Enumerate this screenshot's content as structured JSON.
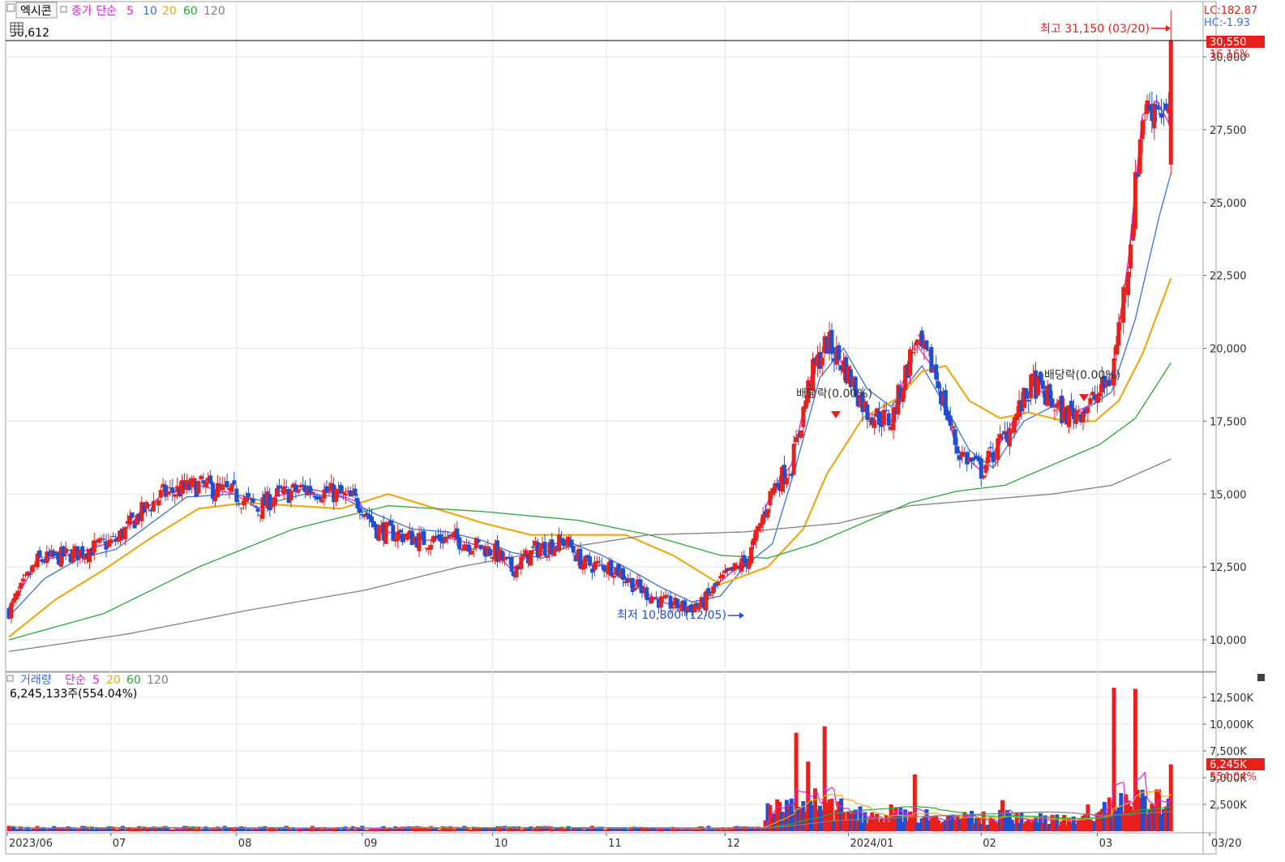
{
  "header": {
    "stock_name": "엑시콘",
    "price_ma_label": "종가 단순",
    "ma_periods": [
      "5",
      "10",
      "20",
      "60",
      "120"
    ],
    "top_left_value": "30,612",
    "lc_label": "LC:182.87",
    "hc_label": "HC:-1.93"
  },
  "volume_header": {
    "label": "거래량",
    "ma_label": "단순",
    "ma_periods": [
      "5",
      "20",
      "60",
      "120"
    ],
    "value_text": "6,245,133주(554.04%)"
  },
  "colors": {
    "up": "#e8201c",
    "down": "#1f4fd0",
    "ma5": "#e020e0",
    "ma10": "#3a70e0",
    "ma20": "#f0a818",
    "ma60": "#28a838",
    "ma120": "#808080",
    "price_tag_bg": "#e8201c"
  },
  "chart_data": [
    {
      "type": "candlestick",
      "y_ticks": [
        10000,
        12500,
        15000,
        17500,
        20000,
        22500,
        25000,
        27500,
        30000
      ],
      "y_tick_labels": [
        "10,000",
        "12,500",
        "15,000",
        "17,500",
        "20,000",
        "22,500",
        "25,000",
        "27,500",
        "30,000"
      ],
      "ylim": [
        9000,
        31900
      ],
      "x_tick_labels": [
        "2023/06",
        "07",
        "08",
        "09",
        "10",
        "11",
        "12",
        "2024/01",
        "02",
        "03",
        "03/20"
      ],
      "grid": true,
      "current_price": {
        "value": 30550,
        "label": "30,550",
        "change": "16.16%"
      },
      "annotations": [
        {
          "text": "최고 31,150 (03/20)",
          "value": 31150,
          "date": "03/20",
          "kind": "high"
        },
        {
          "text": "최저 10,800 (12/05)",
          "value": 10800,
          "date": "12/05",
          "kind": "low"
        },
        {
          "text": "배당락(0.00%)",
          "kind": "ex-dividend",
          "date": "2023-12-27"
        },
        {
          "text": "배당락(0.00%)",
          "kind": "ex-dividend",
          "date": "2024-02-28"
        }
      ],
      "moving_averages": [
        {
          "name": "5",
          "points": [
            [
              0,
              11000
            ],
            [
              12,
              12700
            ],
            [
              30,
              13000
            ],
            [
              45,
              13400
            ],
            [
              55,
              14300
            ],
            [
              65,
              15000
            ],
            [
              80,
              15300
            ],
            [
              95,
              15000
            ],
            [
              105,
              14500
            ],
            [
              112,
              14900
            ],
            [
              125,
              15200
            ],
            [
              138,
              15000
            ],
            [
              148,
              14700
            ],
            [
              155,
              13800
            ],
            [
              165,
              13600
            ],
            [
              175,
              13400
            ],
            [
              185,
              13500
            ],
            [
              195,
              13300
            ],
            [
              205,
              13000
            ],
            [
              212,
              12400
            ],
            [
              222,
              13100
            ],
            [
              235,
              13400
            ],
            [
              242,
              12600
            ],
            [
              255,
              12500
            ],
            [
              265,
              11800
            ],
            [
              275,
              11300
            ],
            [
              285,
              11100
            ],
            [
              292,
              11200
            ],
            [
              300,
              12000
            ],
            [
              312,
              12800
            ],
            [
              322,
              15200
            ],
            [
              330,
              16000
            ],
            [
              338,
              19000
            ],
            [
              345,
              20200
            ],
            [
              352,
              19400
            ],
            [
              362,
              17800
            ],
            [
              372,
              17500
            ],
            [
              382,
              20200
            ],
            [
              390,
              19300
            ],
            [
              400,
              16500
            ],
            [
              410,
              15800
            ],
            [
              420,
              17000
            ],
            [
              432,
              18800
            ],
            [
              445,
              17700
            ],
            [
              455,
              18000
            ],
            [
              465,
              19000
            ],
            [
              472,
              23000
            ],
            [
              478,
              28000
            ],
            [
              484,
              28500
            ],
            [
              490,
              27600
            ]
          ]
        },
        {
          "name": "10",
          "points": [
            [
              0,
              10800
            ],
            [
              15,
              12100
            ],
            [
              30,
              12800
            ],
            [
              45,
              13100
            ],
            [
              60,
              14000
            ],
            [
              75,
              14900
            ],
            [
              95,
              15000
            ],
            [
              110,
              14700
            ],
            [
              125,
              15000
            ],
            [
              140,
              14900
            ],
            [
              155,
              14300
            ],
            [
              170,
              13800
            ],
            [
              185,
              13700
            ],
            [
              200,
              13400
            ],
            [
              212,
              13000
            ],
            [
              225,
              12800
            ],
            [
              238,
              13300
            ],
            [
              250,
              12900
            ],
            [
              262,
              12400
            ],
            [
              275,
              11800
            ],
            [
              288,
              11300
            ],
            [
              300,
              11500
            ],
            [
              310,
              12500
            ],
            [
              322,
              13300
            ],
            [
              332,
              16000
            ],
            [
              342,
              19000
            ],
            [
              352,
              20000
            ],
            [
              362,
              18600
            ],
            [
              372,
              18000
            ],
            [
              385,
              19400
            ],
            [
              395,
              18000
            ],
            [
              405,
              16500
            ],
            [
              415,
              15900
            ],
            [
              428,
              17500
            ],
            [
              440,
              18000
            ],
            [
              452,
              17800
            ],
            [
              465,
              18500
            ],
            [
              475,
              21000
            ],
            [
              485,
              24500
            ],
            [
              490,
              26000
            ]
          ]
        },
        {
          "name": "20",
          "points": [
            [
              0,
              10100
            ],
            [
              20,
              11400
            ],
            [
              40,
              12400
            ],
            [
              60,
              13500
            ],
            [
              80,
              14500
            ],
            [
              100,
              14700
            ],
            [
              120,
              14600
            ],
            [
              140,
              14500
            ],
            [
              160,
              15000
            ],
            [
              180,
              14500
            ],
            [
              200,
              14000
            ],
            [
              220,
              13600
            ],
            [
              240,
              13600
            ],
            [
              260,
              13600
            ],
            [
              280,
              12900
            ],
            [
              300,
              11900
            ],
            [
              320,
              12500
            ],
            [
              335,
              13800
            ],
            [
              345,
              15700
            ],
            [
              360,
              17600
            ],
            [
              375,
              18300
            ],
            [
              385,
              19200
            ],
            [
              395,
              19400
            ],
            [
              405,
              18200
            ],
            [
              418,
              17600
            ],
            [
              430,
              17800
            ],
            [
              445,
              17500
            ],
            [
              458,
              17500
            ],
            [
              468,
              18200
            ],
            [
              478,
              19800
            ],
            [
              490,
              22400
            ]
          ]
        },
        {
          "name": "60",
          "points": [
            [
              0,
              10000
            ],
            [
              40,
              10900
            ],
            [
              80,
              12500
            ],
            [
              120,
              13800
            ],
            [
              160,
              14600
            ],
            [
              200,
              14400
            ],
            [
              240,
              14100
            ],
            [
              270,
              13600
            ],
            [
              300,
              12900
            ],
            [
              320,
              12800
            ],
            [
              340,
              13300
            ],
            [
              360,
              14000
            ],
            [
              380,
              14700
            ],
            [
              400,
              15100
            ],
            [
              420,
              15300
            ],
            [
              440,
              16000
            ],
            [
              460,
              16700
            ],
            [
              475,
              17600
            ],
            [
              490,
              19500
            ]
          ]
        },
        {
          "name": "120",
          "points": [
            [
              0,
              9600
            ],
            [
              50,
              10200
            ],
            [
              100,
              11000
            ],
            [
              150,
              11700
            ],
            [
              190,
              12500
            ],
            [
              230,
              13100
            ],
            [
              270,
              13600
            ],
            [
              310,
              13700
            ],
            [
              350,
              14000
            ],
            [
              380,
              14600
            ],
            [
              410,
              14800
            ],
            [
              440,
              15000
            ],
            [
              465,
              15300
            ],
            [
              490,
              16200
            ]
          ]
        }
      ]
    },
    {
      "type": "bar",
      "name": "volume",
      "y_ticks": [
        2500,
        5000,
        7500,
        10000,
        12500
      ],
      "y_tick_labels": [
        "2,500K",
        "5,000K",
        "7,500K",
        "10,000K",
        "12,500K"
      ],
      "ylim": [
        0,
        14000
      ],
      "current": {
        "label": "6,245K",
        "change": "554.04%"
      },
      "grid": true
    }
  ]
}
